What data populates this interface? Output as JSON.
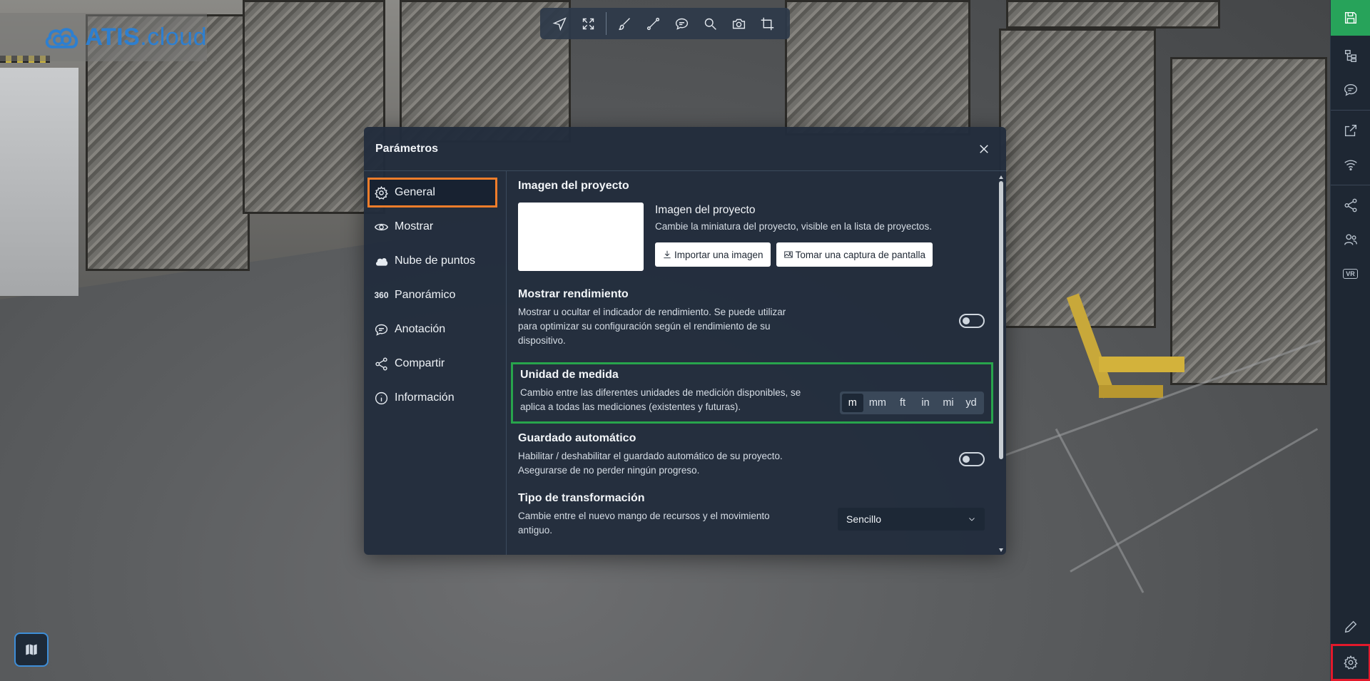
{
  "logo": {
    "brand": "ATIS",
    "suffix": ".cloud"
  },
  "modal": {
    "title": "Parámetros",
    "nav": [
      {
        "label": "General",
        "icon": "gear-icon",
        "active": true
      },
      {
        "label": "Mostrar",
        "icon": "eye-icon"
      },
      {
        "label": "Nube de puntos",
        "icon": "cloud-icon"
      },
      {
        "label": "Panorámico",
        "icon": "360-icon",
        "icon_text": "360"
      },
      {
        "label": "Anotación",
        "icon": "comment-icon"
      },
      {
        "label": "Compartir",
        "icon": "share-icon"
      },
      {
        "label": "Información",
        "icon": "info-icon"
      }
    ],
    "project_image": {
      "section_title": "Imagen del proyecto",
      "label": "Imagen del proyecto",
      "description": "Cambie la miniatura del proyecto, visible en la lista de proyectos.",
      "import_button": "Importar una imagen",
      "capture_button": "Tomar una captura de pantalla"
    },
    "performance": {
      "title": "Mostrar rendimiento",
      "description": "Mostrar u ocultar el indicador de rendimiento. Se puede utilizar para optimizar su configuración según el rendimiento de su dispositivo.",
      "enabled": false
    },
    "units": {
      "title": "Unidad de medida",
      "description": "Cambio entre las diferentes unidades de medición disponibles, se aplica a todas las mediciones (existentes y futuras).",
      "options": [
        "m",
        "mm",
        "ft",
        "in",
        "mi",
        "yd"
      ],
      "selected": "m"
    },
    "autosave": {
      "title": "Guardado automático",
      "description": "Habilitar / deshabilitar el guardado automático de su proyecto. Asegurarse de no perder ningún progreso.",
      "enabled": false
    },
    "transform": {
      "title": "Tipo de transformación",
      "description": "Cambie entre el nuevo mango de recursos y el movimiento antiguo.",
      "value": "Sencillo"
    }
  },
  "colors": {
    "save_button": "#27a35a",
    "active_nav_outline": "#f07d2a",
    "units_highlight": "#28a44c",
    "settings_highlight": "#e3192b",
    "brand_blue": "#2d7fd0"
  }
}
